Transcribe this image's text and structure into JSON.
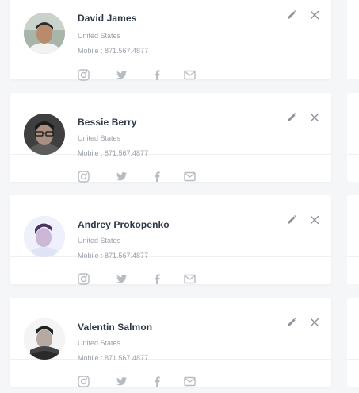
{
  "contacts": [
    {
      "name": "David James",
      "country": "United States",
      "mobile": "Mobile : 871.567.4877"
    },
    {
      "name": "Bessie Berry",
      "country": "United States",
      "mobile": "Mobile : 871.567.4877"
    },
    {
      "name": "Andrey Prokopenko",
      "country": "United States",
      "mobile": "Mobile : 871.567.4877"
    },
    {
      "name": "Valentin Salmon",
      "country": "United States",
      "mobile": "Mobile : 871.567.4877"
    }
  ],
  "icons": {
    "edit": "pencil-icon",
    "close": "close-icon",
    "social": [
      "instagram-icon",
      "twitter-icon",
      "facebook-icon",
      "mail-icon"
    ]
  },
  "colors": {
    "background": "#f5f6f8",
    "card": "#ffffff",
    "name_text": "#2d3748",
    "muted_text": "#9aa1ab",
    "action_icon": "#8c939d",
    "social_icon": "#b7bcc4"
  }
}
